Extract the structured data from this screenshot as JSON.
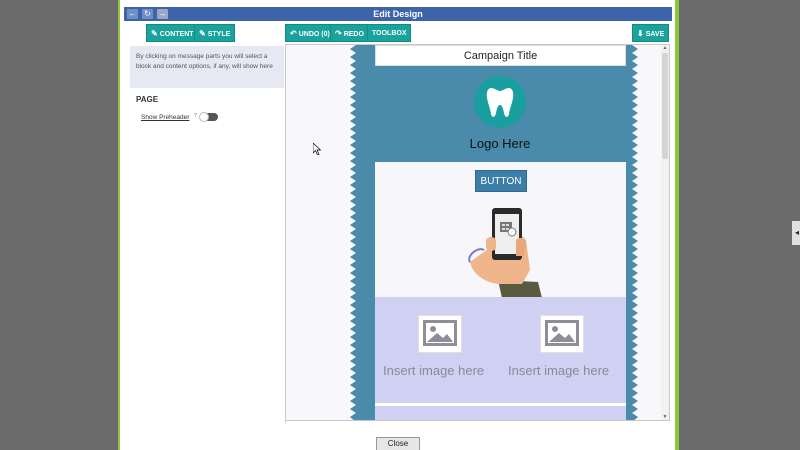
{
  "window": {
    "title": "Edit Design",
    "nav_buttons": [
      "←",
      "↻",
      "→"
    ]
  },
  "toolbar": {
    "content_label": "CONTENT",
    "style_label": "STYLE",
    "undo_label": "UNDO (0)",
    "redo_label": "REDO",
    "toolbox_label": "TOOLBOX",
    "save_label": "SAVE"
  },
  "left_panel": {
    "hint": "By clicking on message parts you will select a block and content options, if any, will show here",
    "section_label": "PAGE",
    "preheader_label": "Show Preheader",
    "preheader_help": "?",
    "preheader_enabled": false
  },
  "email": {
    "campaign_title": "Campaign Title",
    "logo_text": "Logo Here",
    "button_label": "BUTTON",
    "image_label_1": "Insert image here",
    "image_label_2": "Insert image here",
    "background_color": "#4a8aaa",
    "logo_color": "#1a9fa0"
  },
  "footer": {
    "close_label": "Close"
  },
  "side_tab": "◂",
  "colors": {
    "titlebar": "#3d63a8",
    "accent": "#1aa39c",
    "frame": "#8dc63f"
  }
}
